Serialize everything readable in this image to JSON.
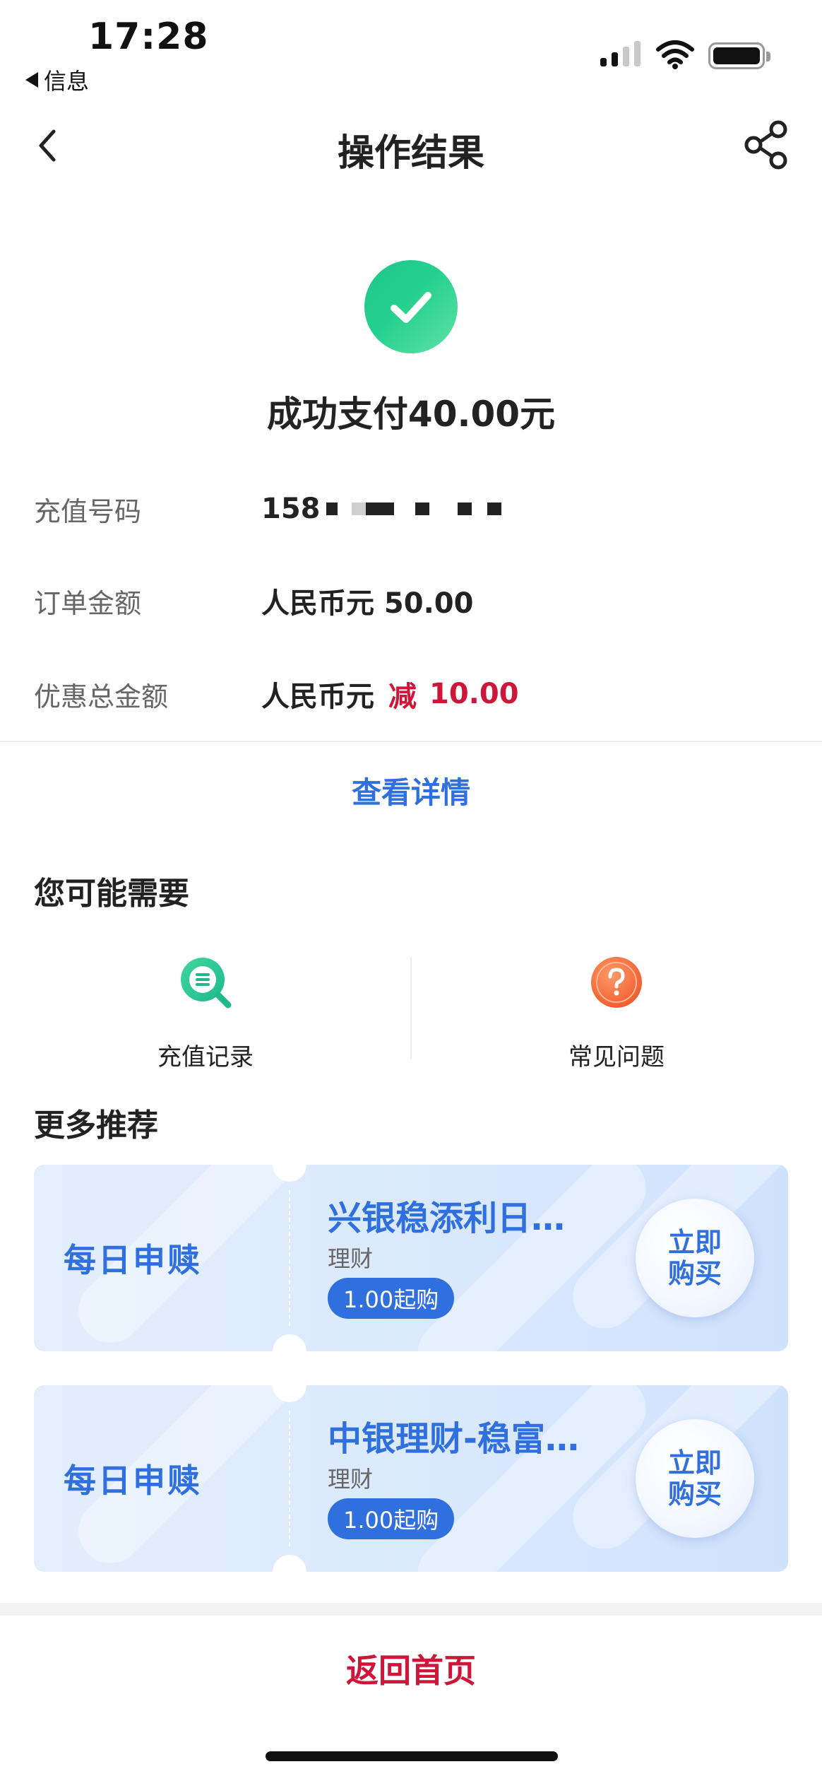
{
  "status_bar": {
    "time": "17:28",
    "back_app": "信息"
  },
  "nav": {
    "title": "操作结果",
    "back_icon": "chevron-left-icon",
    "share_icon": "share-icon"
  },
  "result": {
    "icon": "check-circle-icon",
    "title": "成功支付40.00元",
    "success_color": "#25d08e"
  },
  "details": {
    "phone": {
      "label": "充值号码",
      "value_visible": "158"
    },
    "order_amount": {
      "label": "订单金额",
      "value": "人民币元 50.00"
    },
    "discount": {
      "label": "优惠总金额",
      "currency": "人民币元",
      "minus": "减",
      "amount": "10.00"
    }
  },
  "view_detail": "查看详情",
  "you_may_need": {
    "title": "您可能需要",
    "items": [
      {
        "label": "充值记录",
        "icon": "search-list-icon"
      },
      {
        "label": "常见问题",
        "icon": "question-icon"
      }
    ]
  },
  "more": {
    "title": "更多推荐",
    "cards": [
      {
        "tag": "每日申赎",
        "name": "兴银稳添利日…",
        "type": "理财",
        "badge": "1.00起购",
        "buy": [
          "立即",
          "购买"
        ]
      },
      {
        "tag": "每日申赎",
        "name": "中银理财-稳富…",
        "type": "理财",
        "badge": "1.00起购",
        "buy": [
          "立即",
          "购买"
        ]
      }
    ]
  },
  "home_button": "返回首页",
  "colors": {
    "accent_blue": "#2f6fde",
    "accent_red": "#d0153a"
  }
}
